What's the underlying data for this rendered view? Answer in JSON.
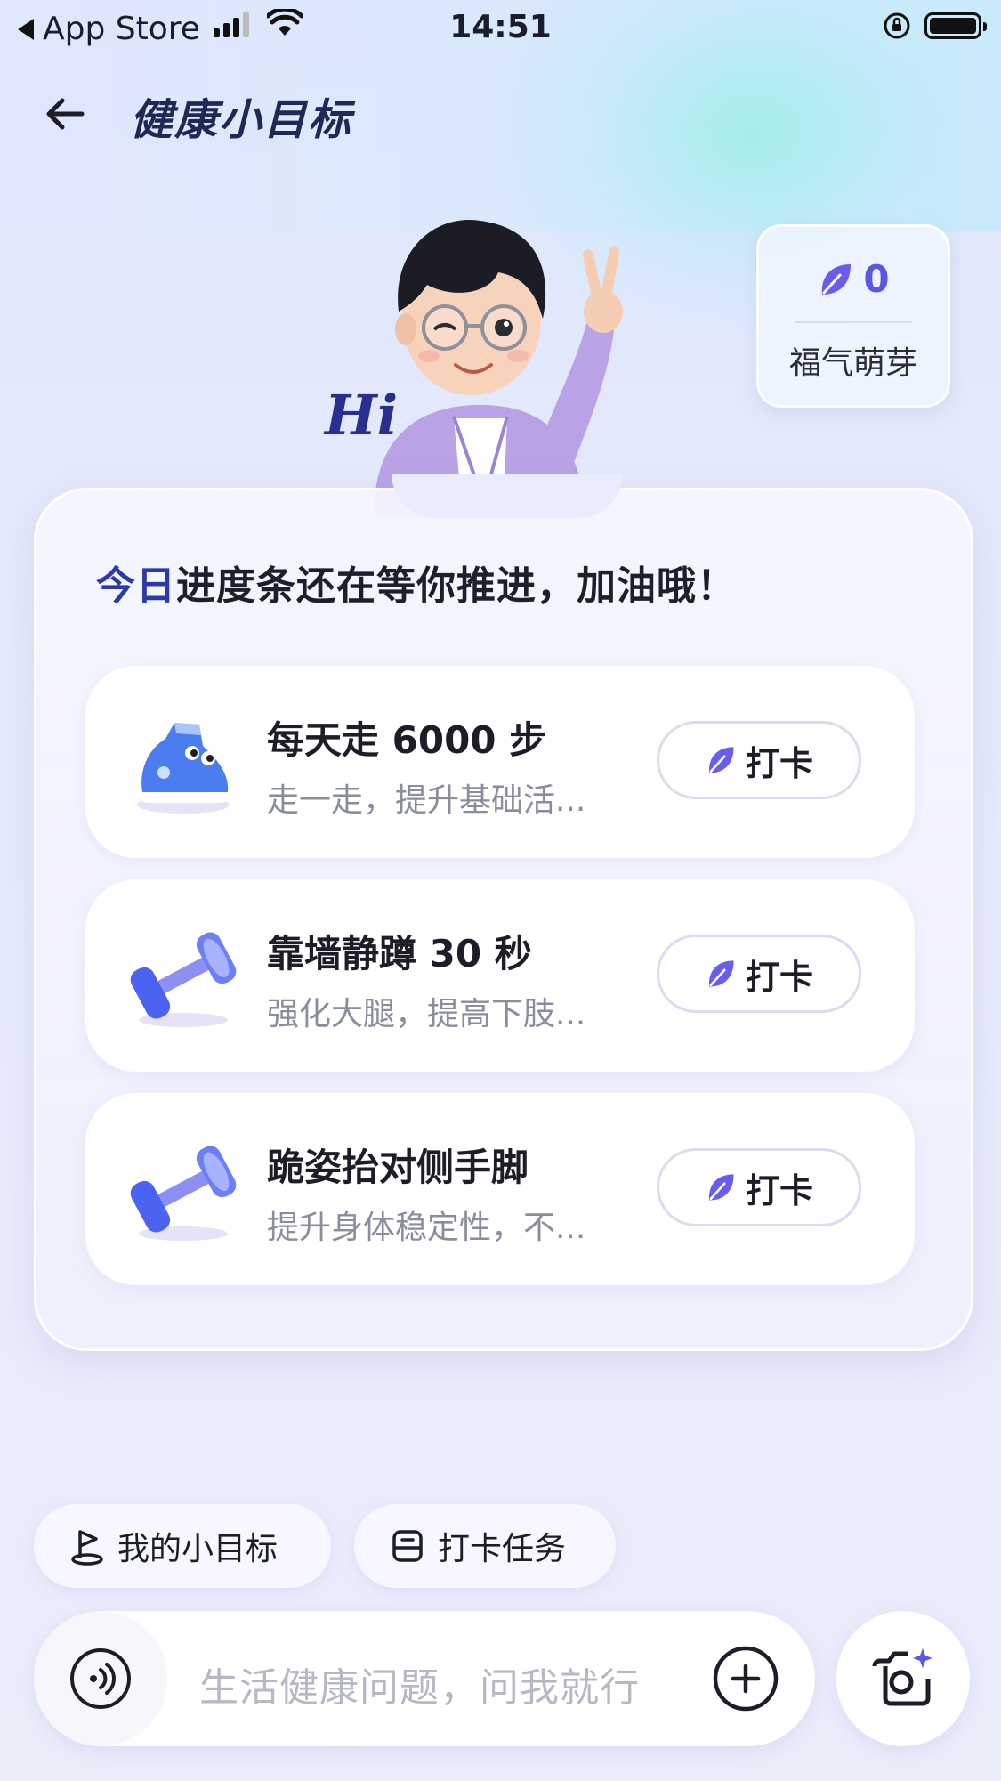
{
  "status_bar": {
    "back_app": "App Store",
    "time": "14:51"
  },
  "header": {
    "title": "健康小目标"
  },
  "hero": {
    "greeting": "Hi"
  },
  "fortune": {
    "count": "0",
    "label": "福气萌芽"
  },
  "card": {
    "headline_accent": "今日",
    "headline_rest": "进度条还在等你推进，加油哦！",
    "tasks": [
      {
        "title": "每天走 6000 步",
        "desc": "走一走，提升基础活...",
        "icon": "sneaker-icon",
        "button": "打卡"
      },
      {
        "title": "靠墙静蹲 30 秒",
        "desc": "强化大腿，提高下肢...",
        "icon": "dumbbell-icon",
        "button": "打卡"
      },
      {
        "title": "跪姿抬对侧手脚",
        "desc": "提升身体稳定性，不...",
        "icon": "dumbbell-icon",
        "button": "打卡"
      }
    ]
  },
  "chips": {
    "my_goals": "我的小目标",
    "checkin_tasks": "打卡任务"
  },
  "input": {
    "placeholder": "生活健康问题，问我就行"
  },
  "colors": {
    "accent": "#5a57e6",
    "leaf": "#6a5cf0",
    "headline_accent": "#2b3aa8"
  }
}
